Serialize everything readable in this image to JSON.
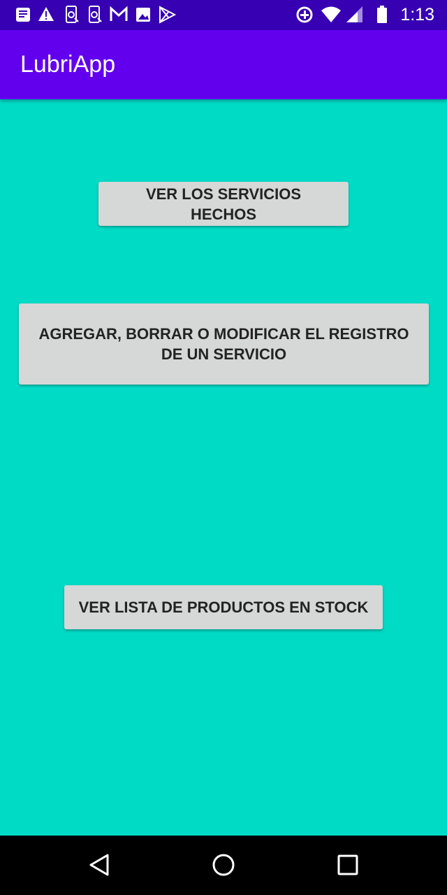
{
  "status_bar": {
    "time": "1:13",
    "icons": [
      "notes-icon",
      "warning-icon",
      "phone-sync-icon",
      "phone-sync-icon",
      "gmail-icon",
      "image-icon",
      "play-store-icon",
      "data-saver-icon",
      "wifi-icon",
      "signal-icon",
      "battery-icon"
    ]
  },
  "app_bar": {
    "title": "LubriApp"
  },
  "main": {
    "buttons": [
      {
        "label": "VER LOS SERVICIOS HECHOS"
      },
      {
        "label": "AGREGAR, BORRAR O MODIFICAR EL REGISTRO DE UN SERVICIO"
      },
      {
        "label": "VER LISTA DE PRODUCTOS EN STOCK"
      }
    ]
  },
  "nav_bar": {
    "items": [
      "back-icon",
      "home-icon",
      "recents-icon"
    ]
  },
  "colors": {
    "status_bar": "#3700B3",
    "app_bar": "#6200EE",
    "background": "#00DBC6",
    "button": "#D6D7D7",
    "button_text": "#232323"
  }
}
